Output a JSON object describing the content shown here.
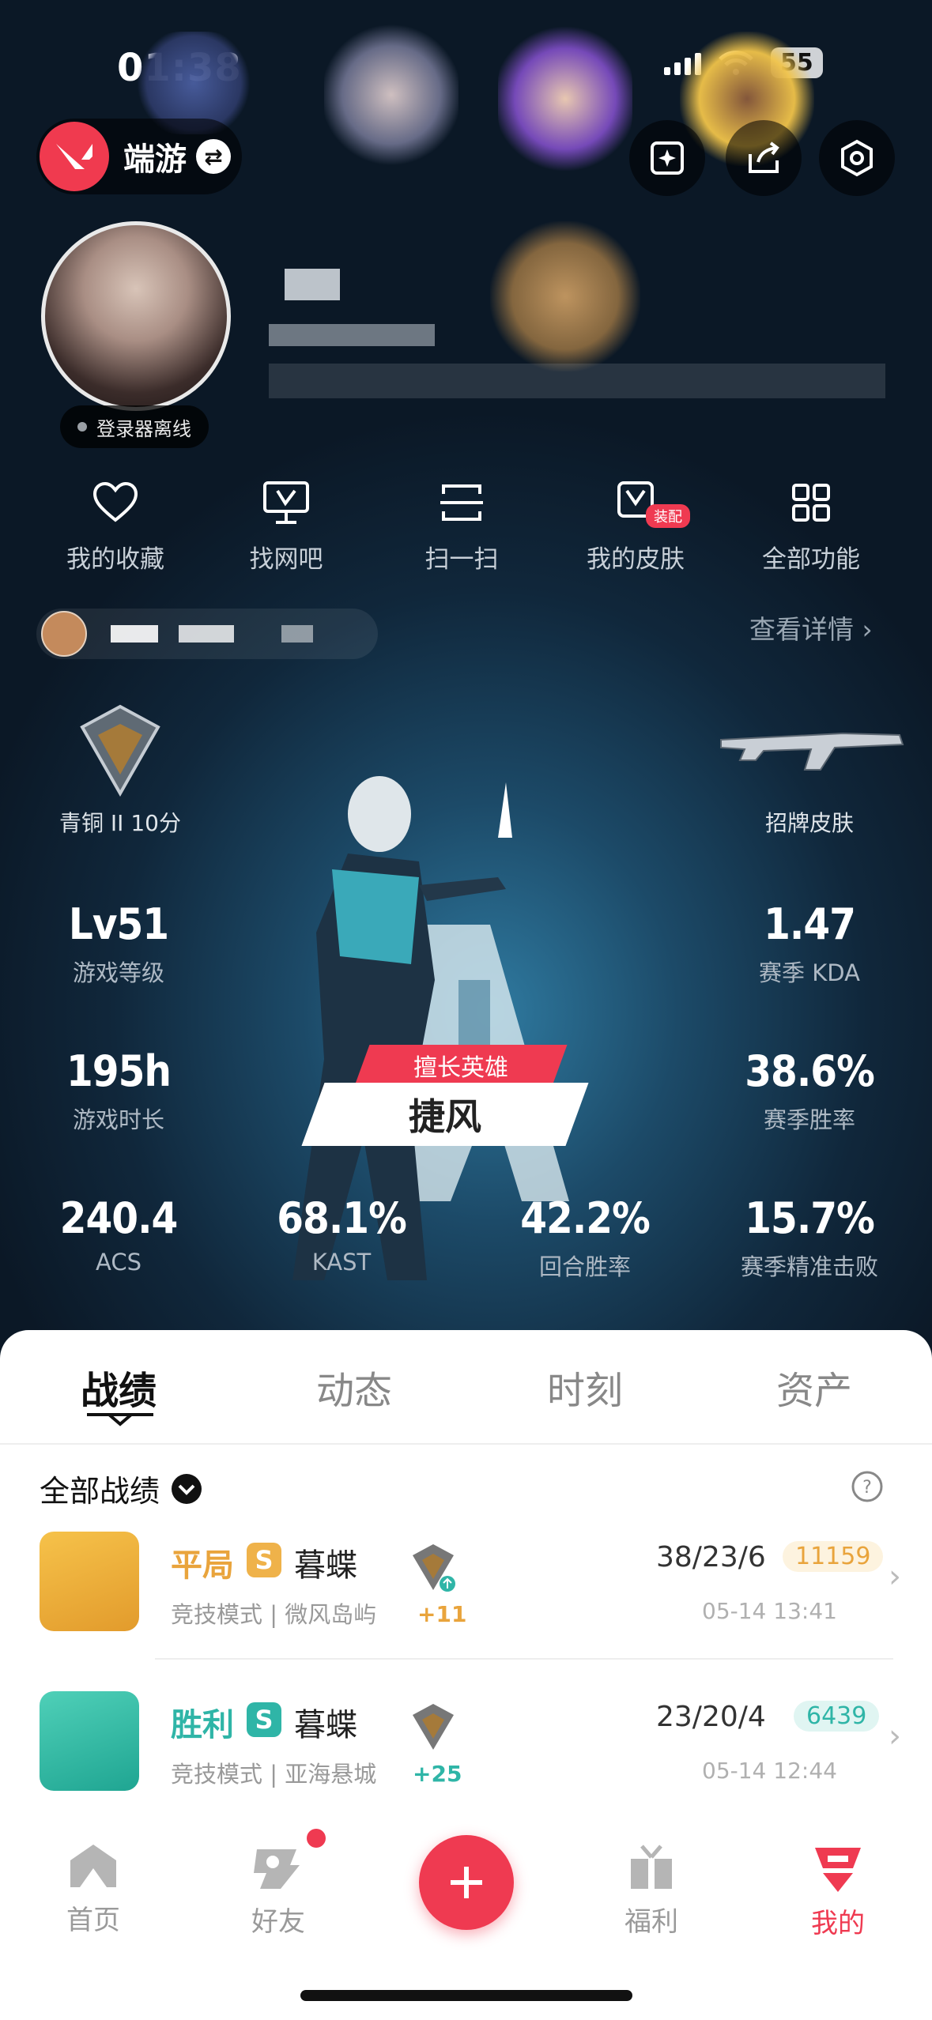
{
  "status_bar": {
    "time": "01:38",
    "battery": "55"
  },
  "brand": {
    "name": "端游"
  },
  "profile": {
    "status": "登录器离线"
  },
  "quick_menu": [
    {
      "label": "我的收藏",
      "icon": "heart-icon"
    },
    {
      "label": "找网吧",
      "icon": "monitor-icon"
    },
    {
      "label": "扫一扫",
      "icon": "scan-icon"
    },
    {
      "label": "我的皮肤",
      "icon": "skin-icon",
      "badge": "装配"
    },
    {
      "label": "全部功能",
      "icon": "grid-icon"
    }
  ],
  "detail_link": "查看详情",
  "rank": {
    "label": "青铜 II 10分"
  },
  "skin": {
    "label": "招牌皮肤"
  },
  "stats": {
    "level": {
      "value": "Lv51",
      "label": "游戏等级"
    },
    "kda": {
      "value": "1.47",
      "label": "赛季 KDA"
    },
    "hours": {
      "value": "195h",
      "label": "游戏时长"
    },
    "winrate": {
      "value": "38.6%",
      "label": "赛季胜率"
    },
    "acs": {
      "value": "240.4",
      "label": "ACS"
    },
    "kast": {
      "value": "68.1%",
      "label": "KAST"
    },
    "round_win": {
      "value": "42.2%",
      "label": "回合胜率"
    },
    "headshot": {
      "value": "15.7%",
      "label": "赛季精准击败"
    }
  },
  "best_hero": {
    "tag": "擅长英雄",
    "name": "捷风"
  },
  "tabs": [
    "战绩",
    "动态",
    "时刻",
    "资产"
  ],
  "filter": {
    "label": "全部战绩"
  },
  "matches": [
    {
      "result": "平局",
      "result_color": "#e9a43c",
      "badge": "S",
      "agent": "暮蝶",
      "mode": "竞技模式 | 微风岛屿",
      "delta": "+11",
      "kda": "38/23/6",
      "score": "11159",
      "score_bg": "#fdf3df",
      "score_color": "#e9a43c",
      "time": "05-14 13:41"
    },
    {
      "result": "胜利",
      "result_color": "#2fb5a7",
      "badge": "S",
      "agent": "暮蝶",
      "mode": "竞技模式 | 亚海悬城",
      "delta": "+25",
      "kda": "23/20/4",
      "score": "6439",
      "score_bg": "#e0f5f2",
      "score_color": "#2fb5a7",
      "time": "05-14 12:44"
    }
  ],
  "nav": [
    {
      "label": "首页",
      "icon": "home-icon"
    },
    {
      "label": "好友",
      "icon": "friends-icon"
    },
    {
      "label": "福利",
      "icon": "gift-icon"
    },
    {
      "label": "我的",
      "icon": "profile-icon"
    }
  ],
  "colors": {
    "accent": "#ef3a51",
    "draw": "#e9a43c",
    "win": "#2fb5a7"
  }
}
